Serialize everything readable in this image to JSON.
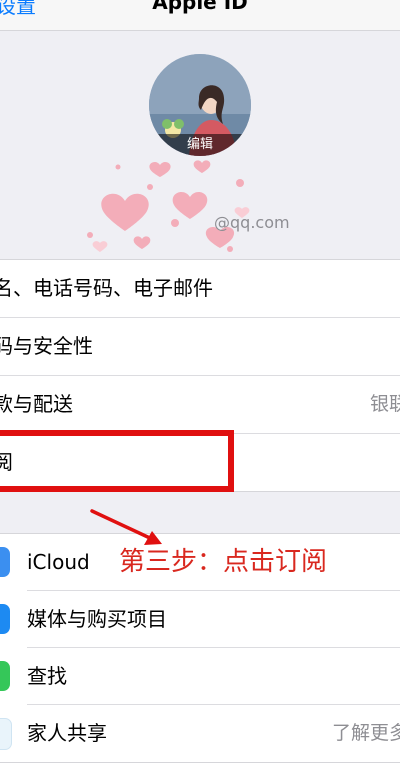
{
  "navbar": {
    "back_label": "设置",
    "title": "Apple ID"
  },
  "profile": {
    "edit_label": "编辑",
    "email": "@qq.com"
  },
  "account_section": [
    {
      "label": "名、电话号码、电子邮件",
      "detail": ""
    },
    {
      "label": "码与安全性",
      "detail": ""
    },
    {
      "label": "款与配送",
      "detail": "银联"
    },
    {
      "label": "阅",
      "detail": ""
    }
  ],
  "services_section": [
    {
      "label": "iCloud",
      "detail": "",
      "icon": "icloud-icon",
      "color": "#3b8ff0"
    },
    {
      "label": "媒体与购买项目",
      "detail": "",
      "icon": "app-store-icon",
      "color": "#1d8af2"
    },
    {
      "label": "查找",
      "detail": "",
      "icon": "find-my-icon",
      "color": "#35c759"
    },
    {
      "label": "家人共享",
      "detail": "了解更多",
      "icon": "family-sharing-icon",
      "color": "#5ac8fa"
    }
  ],
  "annotation": {
    "step_text": "第三步：点击订阅",
    "color": "#e01010"
  }
}
